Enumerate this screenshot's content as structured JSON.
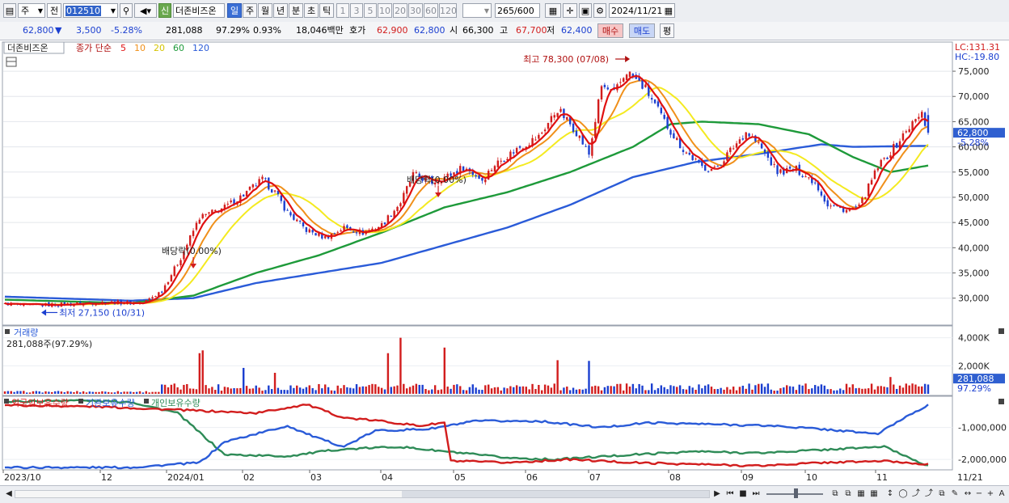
{
  "toolbar": {
    "period_select": "주",
    "mode_select": "전",
    "code_value": "012510",
    "new_badge": "신",
    "stock_name": "더존비즈온",
    "periods": [
      "일",
      "주",
      "월",
      "년",
      "분",
      "초",
      "틱"
    ],
    "active_period": "일",
    "intervals": [
      "1",
      "3",
      "5",
      "10",
      "20",
      "30",
      "60",
      "120"
    ],
    "count_value": "265",
    "count_total": "/600",
    "date_value": "2024/11/21"
  },
  "quote": {
    "price": "62,800",
    "change": "3,500",
    "change_pct": "-5.28%",
    "volume": "281,088",
    "vol_ratio": "97.29%",
    "turnover": "0.93%",
    "amount": "18,046백만",
    "bid_label": "호가",
    "ask_price": "62,900",
    "bid_price": "62,800",
    "open_label": "시",
    "open": "66,300",
    "high_label": "고",
    "high": "67,700",
    "low_label": "저",
    "low": "62,400",
    "buy_button": "매수",
    "sell_button": "매도",
    "eval_button": "평"
  },
  "colors": {
    "up": "#d21d1d",
    "down": "#1b3fd0",
    "ma5": "#e01010",
    "ma10": "#f0901a",
    "ma20": "#f4ea20",
    "ma60": "#1e9a3a",
    "ma120": "#2a5bd8",
    "foreign": "#d21d1d",
    "institution": "#2a5bd8",
    "individual": "#2e8b57"
  },
  "chart_data": [
    {
      "type": "candlestick",
      "title": "더존비즈온",
      "legend": {
        "label": "종가 단순",
        "periods": [
          "5",
          "10",
          "20",
          "60",
          "120"
        ]
      },
      "y_ticks": [
        "75,000",
        "70,000",
        "65,000",
        "60,000",
        "55,000",
        "50,000",
        "45,000",
        "40,000",
        "35,000",
        "30,000"
      ],
      "y_tick_values": [
        75000,
        70000,
        65000,
        60000,
        55000,
        50000,
        45000,
        40000,
        35000,
        30000
      ],
      "ylim": [
        25300,
        79500
      ],
      "x_labels": [
        "2023/10",
        "12",
        "2024/01",
        "02",
        "03",
        "04",
        "05",
        "06",
        "07",
        "08",
        "09",
        "10",
        "11",
        "11/21"
      ],
      "lc_label": "LC:131.31",
      "hc_label": "HC:-19.80",
      "last_price_label": "62,800",
      "last_change_label": "-5.28%",
      "high_annotation": "최고 78,300 (07/08)",
      "low_annotation": "최저 27,150 (10/31)",
      "dividend_annotations": [
        "배당락(0.00%)",
        "배당락(0.00%)"
      ],
      "close_path": [
        {
          "t": 0,
          "close": 29000
        },
        {
          "t": 6,
          "close": 28500
        },
        {
          "t": 20,
          "close": 28800
        },
        {
          "t": 32,
          "close": 29200
        },
        {
          "t": 44,
          "close": 29000
        },
        {
          "t": 50,
          "close": 31500
        },
        {
          "t": 56,
          "close": 38000
        },
        {
          "t": 62,
          "close": 46000
        },
        {
          "t": 70,
          "close": 48000
        },
        {
          "t": 76,
          "close": 50500
        },
        {
          "t": 82,
          "close": 53500
        },
        {
          "t": 86,
          "close": 51000
        },
        {
          "t": 90,
          "close": 47000
        },
        {
          "t": 96,
          "close": 43500
        },
        {
          "t": 102,
          "close": 42000
        },
        {
          "t": 108,
          "close": 44000
        },
        {
          "t": 114,
          "close": 43000
        },
        {
          "t": 120,
          "close": 44500
        },
        {
          "t": 126,
          "close": 49000
        },
        {
          "t": 130,
          "close": 54500
        },
        {
          "t": 136,
          "close": 53000
        },
        {
          "t": 142,
          "close": 54500
        },
        {
          "t": 146,
          "close": 56000
        },
        {
          "t": 152,
          "close": 53500
        },
        {
          "t": 156,
          "close": 56500
        },
        {
          "t": 164,
          "close": 60000
        },
        {
          "t": 170,
          "close": 62000
        },
        {
          "t": 176,
          "close": 67500
        },
        {
          "t": 182,
          "close": 63000
        },
        {
          "t": 186,
          "close": 58500
        },
        {
          "t": 190,
          "close": 72000
        },
        {
          "t": 194,
          "close": 70500
        },
        {
          "t": 198,
          "close": 75000
        },
        {
          "t": 204,
          "close": 71500
        },
        {
          "t": 210,
          "close": 65000
        },
        {
          "t": 216,
          "close": 59500
        },
        {
          "t": 222,
          "close": 56000
        },
        {
          "t": 226,
          "close": 55500
        },
        {
          "t": 232,
          "close": 60000
        },
        {
          "t": 236,
          "close": 63000
        },
        {
          "t": 240,
          "close": 60500
        },
        {
          "t": 246,
          "close": 55000
        },
        {
          "t": 252,
          "close": 55500
        },
        {
          "t": 258,
          "close": 53000
        },
        {
          "t": 262,
          "close": 48500
        },
        {
          "t": 268,
          "close": 47500
        },
        {
          "t": 272,
          "close": 48000
        },
        {
          "t": 278,
          "close": 56000
        },
        {
          "t": 284,
          "close": 60500
        },
        {
          "t": 288,
          "close": 64000
        },
        {
          "t": 292,
          "close": 66500
        },
        {
          "t": 294,
          "close": 62800
        }
      ],
      "ma60_path": [
        {
          "t": 0,
          "value": 29700
        },
        {
          "t": 40,
          "value": 29000
        },
        {
          "t": 60,
          "value": 30500
        },
        {
          "t": 80,
          "value": 35000
        },
        {
          "t": 100,
          "value": 38500
        },
        {
          "t": 120,
          "value": 43000
        },
        {
          "t": 140,
          "value": 48000
        },
        {
          "t": 160,
          "value": 51000
        },
        {
          "t": 180,
          "value": 55000
        },
        {
          "t": 200,
          "value": 60000
        },
        {
          "t": 212,
          "value": 64500
        },
        {
          "t": 222,
          "value": 65000
        },
        {
          "t": 240,
          "value": 64500
        },
        {
          "t": 256,
          "value": 62500
        },
        {
          "t": 270,
          "value": 58000
        },
        {
          "t": 282,
          "value": 55000
        },
        {
          "t": 294,
          "value": 56300
        }
      ],
      "ma120_path": [
        {
          "t": 0,
          "value": 30300
        },
        {
          "t": 40,
          "value": 29500
        },
        {
          "t": 60,
          "value": 30000
        },
        {
          "t": 80,
          "value": 33000
        },
        {
          "t": 100,
          "value": 35000
        },
        {
          "t": 120,
          "value": 37000
        },
        {
          "t": 140,
          "value": 40500
        },
        {
          "t": 160,
          "value": 44000
        },
        {
          "t": 180,
          "value": 48500
        },
        {
          "t": 200,
          "value": 54000
        },
        {
          "t": 220,
          "value": 57000
        },
        {
          "t": 240,
          "value": 58600
        },
        {
          "t": 260,
          "value": 60500
        },
        {
          "t": 270,
          "value": 60000
        },
        {
          "t": 294,
          "value": 60200
        }
      ]
    },
    {
      "type": "bar",
      "title": "거래량",
      "subtitle": "281,088주(97.29%)",
      "y_ticks": [
        "4,000K",
        "2,000K"
      ],
      "y_tick_values": [
        4000,
        2000
      ],
      "ylim": [
        0,
        4500
      ],
      "unit": "K",
      "last_value_label": "281,088",
      "last_ratio_label": "97.29%",
      "spikes": [
        {
          "t": 62,
          "value": 2900
        },
        {
          "t": 63,
          "value": 3100
        },
        {
          "t": 76,
          "value": 1850
        },
        {
          "t": 86,
          "value": 1500
        },
        {
          "t": 122,
          "value": 2900
        },
        {
          "t": 126,
          "value": 4000
        },
        {
          "t": 140,
          "value": 3300
        },
        {
          "t": 176,
          "value": 2400
        },
        {
          "t": 186,
          "value": 2350
        },
        {
          "t": 282,
          "value": 1200
        }
      ]
    },
    {
      "type": "line",
      "series": [
        {
          "name": "외국인보유수량",
          "color_key": "foreign"
        },
        {
          "name": "기관보유수량",
          "color_key": "institution"
        },
        {
          "name": "개인보유수량",
          "color_key": "individual"
        }
      ],
      "y_ticks": [
        "-1,000,000",
        "-2,000,000"
      ],
      "y_tick_values": [
        -1000000,
        -2000000
      ],
      "ylim": [
        -2300000,
        -100000
      ],
      "foreign_path": [
        {
          "t": 0,
          "value": -300000
        },
        {
          "t": 30,
          "value": -350000
        },
        {
          "t": 55,
          "value": -450000
        },
        {
          "t": 80,
          "value": -550000
        },
        {
          "t": 96,
          "value": -280000
        },
        {
          "t": 108,
          "value": -700000
        },
        {
          "t": 120,
          "value": -800000
        },
        {
          "t": 132,
          "value": -950000
        },
        {
          "t": 140,
          "value": -850000
        },
        {
          "t": 142,
          "value": -2050000
        },
        {
          "t": 160,
          "value": -2100000
        },
        {
          "t": 180,
          "value": -2000000
        },
        {
          "t": 200,
          "value": -2100000
        },
        {
          "t": 220,
          "value": -2150000
        },
        {
          "t": 240,
          "value": -2200000
        },
        {
          "t": 260,
          "value": -2100000
        },
        {
          "t": 280,
          "value": -2050000
        },
        {
          "t": 294,
          "value": -2150000
        }
      ],
      "institution_path": [
        {
          "t": 0,
          "value": -2250000
        },
        {
          "t": 40,
          "value": -2250000
        },
        {
          "t": 62,
          "value": -2100000
        },
        {
          "t": 70,
          "value": -1450000
        },
        {
          "t": 90,
          "value": -950000
        },
        {
          "t": 100,
          "value": -1350000
        },
        {
          "t": 108,
          "value": -1600000
        },
        {
          "t": 118,
          "value": -1100000
        },
        {
          "t": 135,
          "value": -1050000
        },
        {
          "t": 150,
          "value": -800000
        },
        {
          "t": 170,
          "value": -800000
        },
        {
          "t": 190,
          "value": -1000000
        },
        {
          "t": 205,
          "value": -850000
        },
        {
          "t": 225,
          "value": -900000
        },
        {
          "t": 245,
          "value": -950000
        },
        {
          "t": 260,
          "value": -1050000
        },
        {
          "t": 278,
          "value": -1200000
        },
        {
          "t": 288,
          "value": -600000
        },
        {
          "t": 294,
          "value": -300000
        }
      ],
      "individual_path": [
        {
          "t": 0,
          "value": -200000
        },
        {
          "t": 20,
          "value": -150000
        },
        {
          "t": 40,
          "value": -200000
        },
        {
          "t": 55,
          "value": -550000
        },
        {
          "t": 70,
          "value": -1850000
        },
        {
          "t": 90,
          "value": -1900000
        },
        {
          "t": 105,
          "value": -1700000
        },
        {
          "t": 125,
          "value": -1600000
        },
        {
          "t": 145,
          "value": -1800000
        },
        {
          "t": 160,
          "value": -1950000
        },
        {
          "t": 175,
          "value": -2000000
        },
        {
          "t": 200,
          "value": -1850000
        },
        {
          "t": 220,
          "value": -1750000
        },
        {
          "t": 240,
          "value": -1800000
        },
        {
          "t": 260,
          "value": -1700000
        },
        {
          "t": 280,
          "value": -1600000
        },
        {
          "t": 294,
          "value": -2200000
        }
      ]
    }
  ]
}
